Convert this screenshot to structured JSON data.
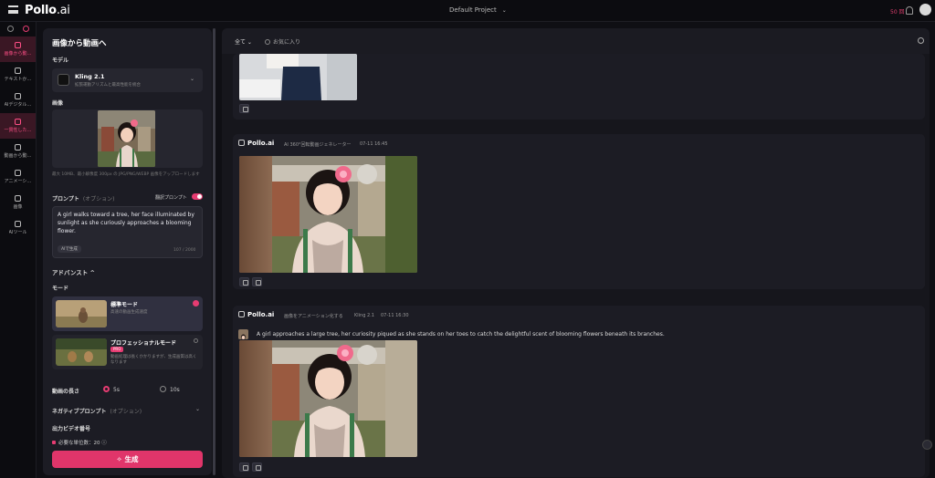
{
  "app": {
    "logo_main": "Pollo",
    "logo_sub": ".ai",
    "project": "Default Project",
    "credits": "50 回"
  },
  "nav": {
    "items": [
      {
        "label": "画像から動…",
        "active": true
      },
      {
        "label": "テキストか…",
        "active": false
      },
      {
        "label": "AIデジタル…",
        "active": false
      },
      {
        "label": "一貫性した…",
        "active": true
      },
      {
        "label": "動画から動…",
        "active": false
      },
      {
        "label": "アニメーシ…",
        "active": false
      },
      {
        "label": "画像",
        "active": false
      },
      {
        "label": "AIツール",
        "active": false
      }
    ]
  },
  "panel": {
    "title": "画像から動画へ",
    "model_label": "モデル",
    "model_name": "Kling 2.1",
    "model_desc": "拡張運動アリズムと最高性能を統合",
    "image_label": "画像",
    "image_help": "最大 10MB、最小解像度 300px の JPG/PNG/WEBP 画像をアップロードします",
    "prompt_label": "プロンプト",
    "prompt_optional": "(オプション)",
    "translate_label": "翻訳プロンプト",
    "prompt_text": "A girl walks toward a tree, her face illuminated by sunlight as she curiously approaches a blooming flower.",
    "ai_button": "AIで生成",
    "char_count": "107 / 2000",
    "advanced_label": "アドバンスト ^",
    "mode_label": "モード",
    "modes": [
      {
        "title": "標準モード",
        "desc": "高速の動画生成速度",
        "selected": true,
        "badge": ""
      },
      {
        "title": "プロフェッショナルモード",
        "desc": "動画処理は長くかかりますが、生成画質は高くなります",
        "selected": false,
        "badge": "PRO"
      }
    ],
    "duration_label": "動画の長さ",
    "duration_options": [
      "5s",
      "10s"
    ],
    "duration_selected": "5s",
    "negative_label": "ネガティブプロンプト",
    "negative_optional": "(オプション)",
    "output_label": "出力ビデオ番号",
    "cost_text": "必要な単位数：20 ⓘ",
    "generate_button": "生成"
  },
  "main": {
    "filter_all": "全て",
    "filter_fav": "お気に入り",
    "cards": [
      {
        "brand": "Pollo.ai",
        "type": "AI 360°回転動画ジェネレーター",
        "time": "07-11 16:45",
        "model": "",
        "prompt": ""
      },
      {
        "brand": "Pollo.ai",
        "type": "画像をアニメーション化する",
        "model": "Kling 2.1",
        "time": "07-11 16:30",
        "prompt": "A girl approaches a large tree, her curiosity piqued as she stands on her toes to catch the delightful scent of blooming flowers beneath its branches."
      }
    ]
  },
  "colors": {
    "accent": "#e0356a",
    "bg": "#0f0f14",
    "panel": "#1c1c24"
  }
}
